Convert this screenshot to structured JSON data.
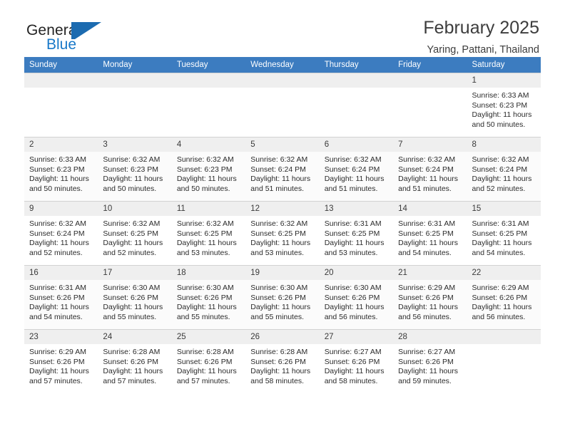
{
  "brand": {
    "name_primary": "General",
    "name_secondary": "Blue",
    "mark": "triangle-flag-logo"
  },
  "header": {
    "title": "February 2025",
    "subtitle": "Yaring, Pattani, Thailand"
  },
  "colors": {
    "header_row_blue": "#3C7CC0",
    "brand_blue": "#1878C8",
    "daynum_band": "#efefef",
    "row_divider": "#d2d2d2"
  },
  "calendar": {
    "weekday_headers": [
      "Sunday",
      "Monday",
      "Tuesday",
      "Wednesday",
      "Thursday",
      "Friday",
      "Saturday"
    ],
    "weeks": [
      [
        {
          "day": "",
          "empty": true
        },
        {
          "day": "",
          "empty": true
        },
        {
          "day": "",
          "empty": true
        },
        {
          "day": "",
          "empty": true
        },
        {
          "day": "",
          "empty": true
        },
        {
          "day": "",
          "empty": true
        },
        {
          "day": "1",
          "sunrise": "Sunrise: 6:33 AM",
          "sunset": "Sunset: 6:23 PM",
          "daylight": "Daylight: 11 hours and 50 minutes."
        }
      ],
      [
        {
          "day": "2",
          "sunrise": "Sunrise: 6:33 AM",
          "sunset": "Sunset: 6:23 PM",
          "daylight": "Daylight: 11 hours and 50 minutes."
        },
        {
          "day": "3",
          "sunrise": "Sunrise: 6:32 AM",
          "sunset": "Sunset: 6:23 PM",
          "daylight": "Daylight: 11 hours and 50 minutes."
        },
        {
          "day": "4",
          "sunrise": "Sunrise: 6:32 AM",
          "sunset": "Sunset: 6:23 PM",
          "daylight": "Daylight: 11 hours and 50 minutes."
        },
        {
          "day": "5",
          "sunrise": "Sunrise: 6:32 AM",
          "sunset": "Sunset: 6:24 PM",
          "daylight": "Daylight: 11 hours and 51 minutes."
        },
        {
          "day": "6",
          "sunrise": "Sunrise: 6:32 AM",
          "sunset": "Sunset: 6:24 PM",
          "daylight": "Daylight: 11 hours and 51 minutes."
        },
        {
          "day": "7",
          "sunrise": "Sunrise: 6:32 AM",
          "sunset": "Sunset: 6:24 PM",
          "daylight": "Daylight: 11 hours and 51 minutes."
        },
        {
          "day": "8",
          "sunrise": "Sunrise: 6:32 AM",
          "sunset": "Sunset: 6:24 PM",
          "daylight": "Daylight: 11 hours and 52 minutes."
        }
      ],
      [
        {
          "day": "9",
          "sunrise": "Sunrise: 6:32 AM",
          "sunset": "Sunset: 6:24 PM",
          "daylight": "Daylight: 11 hours and 52 minutes."
        },
        {
          "day": "10",
          "sunrise": "Sunrise: 6:32 AM",
          "sunset": "Sunset: 6:25 PM",
          "daylight": "Daylight: 11 hours and 52 minutes."
        },
        {
          "day": "11",
          "sunrise": "Sunrise: 6:32 AM",
          "sunset": "Sunset: 6:25 PM",
          "daylight": "Daylight: 11 hours and 53 minutes."
        },
        {
          "day": "12",
          "sunrise": "Sunrise: 6:32 AM",
          "sunset": "Sunset: 6:25 PM",
          "daylight": "Daylight: 11 hours and 53 minutes."
        },
        {
          "day": "13",
          "sunrise": "Sunrise: 6:31 AM",
          "sunset": "Sunset: 6:25 PM",
          "daylight": "Daylight: 11 hours and 53 minutes."
        },
        {
          "day": "14",
          "sunrise": "Sunrise: 6:31 AM",
          "sunset": "Sunset: 6:25 PM",
          "daylight": "Daylight: 11 hours and 54 minutes."
        },
        {
          "day": "15",
          "sunrise": "Sunrise: 6:31 AM",
          "sunset": "Sunset: 6:25 PM",
          "daylight": "Daylight: 11 hours and 54 minutes."
        }
      ],
      [
        {
          "day": "16",
          "sunrise": "Sunrise: 6:31 AM",
          "sunset": "Sunset: 6:26 PM",
          "daylight": "Daylight: 11 hours and 54 minutes."
        },
        {
          "day": "17",
          "sunrise": "Sunrise: 6:30 AM",
          "sunset": "Sunset: 6:26 PM",
          "daylight": "Daylight: 11 hours and 55 minutes."
        },
        {
          "day": "18",
          "sunrise": "Sunrise: 6:30 AM",
          "sunset": "Sunset: 6:26 PM",
          "daylight": "Daylight: 11 hours and 55 minutes."
        },
        {
          "day": "19",
          "sunrise": "Sunrise: 6:30 AM",
          "sunset": "Sunset: 6:26 PM",
          "daylight": "Daylight: 11 hours and 55 minutes."
        },
        {
          "day": "20",
          "sunrise": "Sunrise: 6:30 AM",
          "sunset": "Sunset: 6:26 PM",
          "daylight": "Daylight: 11 hours and 56 minutes."
        },
        {
          "day": "21",
          "sunrise": "Sunrise: 6:29 AM",
          "sunset": "Sunset: 6:26 PM",
          "daylight": "Daylight: 11 hours and 56 minutes."
        },
        {
          "day": "22",
          "sunrise": "Sunrise: 6:29 AM",
          "sunset": "Sunset: 6:26 PM",
          "daylight": "Daylight: 11 hours and 56 minutes."
        }
      ],
      [
        {
          "day": "23",
          "sunrise": "Sunrise: 6:29 AM",
          "sunset": "Sunset: 6:26 PM",
          "daylight": "Daylight: 11 hours and 57 minutes."
        },
        {
          "day": "24",
          "sunrise": "Sunrise: 6:28 AM",
          "sunset": "Sunset: 6:26 PM",
          "daylight": "Daylight: 11 hours and 57 minutes."
        },
        {
          "day": "25",
          "sunrise": "Sunrise: 6:28 AM",
          "sunset": "Sunset: 6:26 PM",
          "daylight": "Daylight: 11 hours and 57 minutes."
        },
        {
          "day": "26",
          "sunrise": "Sunrise: 6:28 AM",
          "sunset": "Sunset: 6:26 PM",
          "daylight": "Daylight: 11 hours and 58 minutes."
        },
        {
          "day": "27",
          "sunrise": "Sunrise: 6:27 AM",
          "sunset": "Sunset: 6:26 PM",
          "daylight": "Daylight: 11 hours and 58 minutes."
        },
        {
          "day": "28",
          "sunrise": "Sunrise: 6:27 AM",
          "sunset": "Sunset: 6:26 PM",
          "daylight": "Daylight: 11 hours and 59 minutes."
        },
        {
          "day": "",
          "empty": true
        }
      ]
    ]
  }
}
